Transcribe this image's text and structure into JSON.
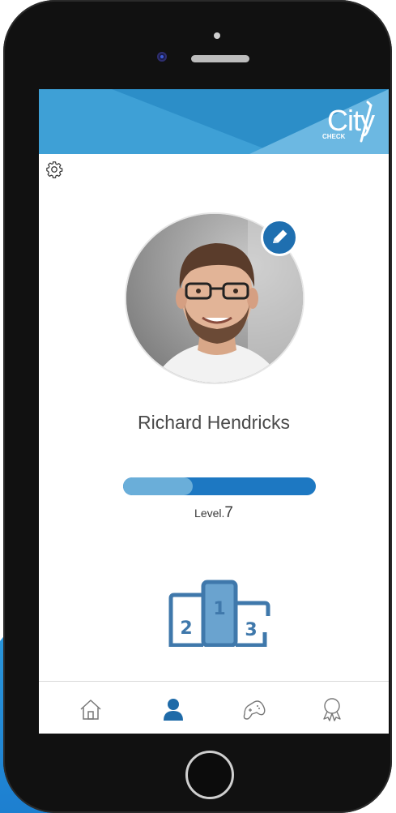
{
  "app": {
    "logo_text": "City",
    "logo_subtext": "CHECK"
  },
  "profile": {
    "name": "Richard Hendricks",
    "level_label": "Level.",
    "level_value": "7",
    "level_progress": 0.36
  },
  "podium": {
    "places": [
      "1",
      "2",
      "3"
    ]
  },
  "colors": {
    "brand_blue": "#3ea0d6",
    "dark_blue": "#1d78c2",
    "progress_light": "#6aaed9",
    "podium_blue": "#3f78ab"
  },
  "icons": {
    "settings": "gear-icon",
    "edit": "pencil-icon",
    "tab_home": "home-icon",
    "tab_profile": "user-icon",
    "tab_games": "gamepad-icon",
    "tab_awards": "award-ribbon-icon"
  }
}
